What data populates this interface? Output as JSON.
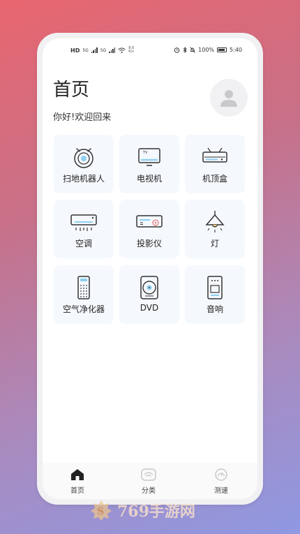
{
  "status_bar": {
    "left_tags": [
      "HD",
      "5G",
      "5G"
    ],
    "speed_value": "8.6",
    "speed_unit": "K/s",
    "battery": "100%",
    "time": "5:40"
  },
  "header": {
    "title": "首页",
    "greeting": "你好!欢迎回来"
  },
  "devices": [
    {
      "label": "扫地机器人",
      "icon": "robot-vacuum-icon"
    },
    {
      "label": "电视机",
      "icon": "tv-icon"
    },
    {
      "label": "机顶盒",
      "icon": "set-top-box-icon"
    },
    {
      "label": "空调",
      "icon": "air-conditioner-icon"
    },
    {
      "label": "投影仪",
      "icon": "projector-icon"
    },
    {
      "label": "灯",
      "icon": "lamp-icon"
    },
    {
      "label": "空气净化器",
      "icon": "air-purifier-icon"
    },
    {
      "label": "DVD",
      "icon": "dvd-icon"
    },
    {
      "label": "音响",
      "icon": "speaker-icon"
    }
  ],
  "tabbar": {
    "items": [
      {
        "label": "首页",
        "icon": "home-icon",
        "active": true
      },
      {
        "label": "分类",
        "icon": "wifi-category-icon",
        "active": false
      },
      {
        "label": "测速",
        "icon": "speedometer-icon",
        "active": false
      }
    ]
  },
  "watermark": {
    "text": "769手游网"
  },
  "colors": {
    "tile_bg": "#f5f9fd",
    "accent_blue": "#8fd0ef",
    "icon_stroke": "#333333"
  }
}
